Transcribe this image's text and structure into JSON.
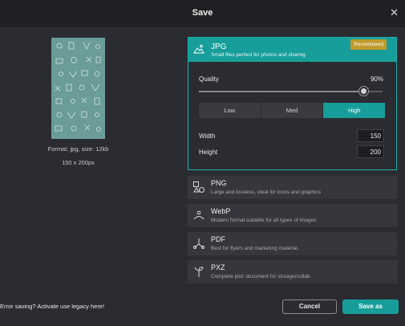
{
  "dialog": {
    "title": "Save"
  },
  "preview": {
    "info": "Format: jpg, size: 12kb",
    "dimensions": "150 x 200px"
  },
  "formats": {
    "jpg": {
      "name": "JPG",
      "desc": "Small files perfect for photos and sharing",
      "badge": "Recommend",
      "icon": "image-mountain-icon",
      "quality_label": "Quality",
      "quality_value": "90%",
      "quality_fraction": 0.9,
      "levels": [
        "Low",
        "Med",
        "High"
      ],
      "selected_level": "High",
      "width_label": "Width",
      "width_value": "150",
      "height_label": "Height",
      "height_value": "200"
    },
    "others": [
      {
        "name": "PNG",
        "desc": "Large and lossless, ideal for icons and graphics",
        "icon": "shapes-icon"
      },
      {
        "name": "WebP",
        "desc": "Modern format suitable for all types of images",
        "icon": "webp-icon"
      },
      {
        "name": "PDF",
        "desc": "Best for flyers and marketing material.",
        "icon": "pdf-icon"
      },
      {
        "name": "PXZ",
        "desc": "Complete pixlr document for storage/collab",
        "icon": "pxz-icon"
      }
    ]
  },
  "footer": {
    "error": "Error saving? Activate use legacy here!",
    "cancel": "Cancel",
    "save": "Save as"
  },
  "colors": {
    "accent": "#179e9a",
    "badge": "#c09a2b",
    "background": "#2b2c31"
  }
}
